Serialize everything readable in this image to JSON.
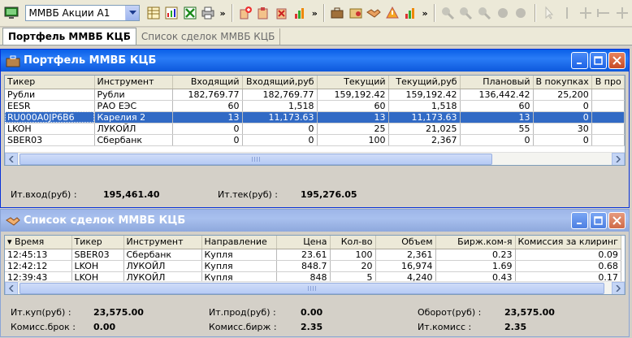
{
  "toolbar": {
    "portfolio_selector": "ММВБ Акции А1",
    "icons_group1": [
      "table-icon",
      "chart-icon",
      "excel-icon",
      "print-icon"
    ],
    "icons_group2": [
      "add-order-icon",
      "order-icon",
      "cancel-order-icon",
      "stats-icon"
    ],
    "icons_group3": [
      "briefcase-icon",
      "settings-icon",
      "handshake-icon",
      "warning-icon",
      "stats-icon"
    ],
    "icons_group4": [
      "zoom-in-icon",
      "zoom-out-icon",
      "zoom-fit-icon",
      "circle-icon",
      "circle-icon"
    ],
    "icons_group5": [
      "cursor-icon",
      "vline-icon",
      "crosshair-icon",
      "hline-icon",
      "grid-icon"
    ],
    "more": "»"
  },
  "tabs": [
    {
      "label": "Портфель ММВБ КЦБ",
      "active": true
    },
    {
      "label": "Список сделок ММВБ КЦБ",
      "active": false
    }
  ],
  "portfolio": {
    "title": "Портфель ММВБ КЦБ",
    "columns": [
      "Тикер",
      "Инструмент",
      "Входящий",
      "Входящий,руб",
      "Текущий",
      "Текущий,руб",
      "Плановый",
      "В покупках",
      "В про"
    ],
    "rows": [
      [
        "Рубли",
        "Рубли",
        "182,769.77",
        "182,769.77",
        "159,192.42",
        "159,192.42",
        "136,442.42",
        "25,200",
        ""
      ],
      [
        "EESR",
        "РАО ЕЭС",
        "60",
        "1,518",
        "60",
        "1,518",
        "60",
        "0",
        ""
      ],
      [
        "RU000A0JP6B6",
        "Карелия 2",
        "13",
        "11,173.63",
        "13",
        "11,173.63",
        "13",
        "0",
        ""
      ],
      [
        "LKOH",
        "ЛУКОЙЛ",
        "0",
        "0",
        "25",
        "21,025",
        "55",
        "30",
        ""
      ],
      [
        "SBER03",
        "Сбербанк",
        "0",
        "0",
        "100",
        "2,367",
        "0",
        "0",
        ""
      ]
    ],
    "selected_row": 2,
    "summary": {
      "in_label": "Ит.вход(руб) :",
      "in_value": "195,461.40",
      "cur_label": "Ит.тек(руб) :",
      "cur_value": "195,276.05"
    }
  },
  "deals": {
    "title": "Список сделок ММВБ КЦБ",
    "columns": [
      "Время",
      "Тикер",
      "Инструмент",
      "Направление",
      "Цена",
      "Кол-во",
      "Объем",
      "Бирж.ком-я",
      "Комиссия за клиринг"
    ],
    "rows": [
      [
        "12:45:13",
        "SBER03",
        "Сбербанк",
        "Купля",
        "23.61",
        "100",
        "2,361",
        "0.23",
        "0.09"
      ],
      [
        "12:42:12",
        "LKOH",
        "ЛУКОЙЛ",
        "Купля",
        "848.7",
        "20",
        "16,974",
        "1.69",
        "0.68"
      ],
      [
        "12:39:43",
        "LKOH",
        "ЛУКОЙЛ",
        "Купля",
        "848",
        "5",
        "4,240",
        "0.43",
        "0.17"
      ]
    ],
    "summary": {
      "buy_label": "Ит.куп(руб) :",
      "buy_value": "23,575.00",
      "sell_label": "Ит.прод(руб) :",
      "sell_value": "0.00",
      "turnover_label": "Оборот(руб) :",
      "turnover_value": "23,575.00",
      "broker_label": "Комисс.брок :",
      "broker_value": "0.00",
      "exch_label": "Комисс.бирж :",
      "exch_value": "2.35",
      "total_label": "Ит.комисс :",
      "total_value": "2.35"
    }
  },
  "colors": {
    "title_active": "#0a5fe8",
    "title_inactive": "#9db5e8",
    "selection": "#316ac5"
  }
}
